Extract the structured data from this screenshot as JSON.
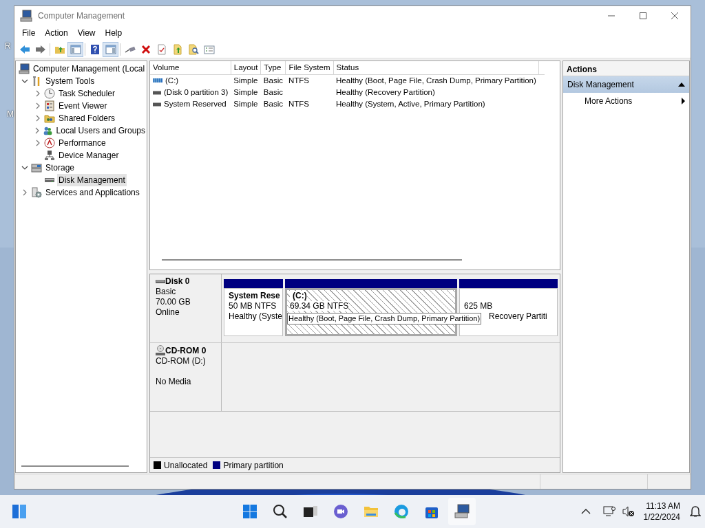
{
  "desktop": {
    "labels": [
      "R",
      "M"
    ]
  },
  "window": {
    "title": "Computer Management"
  },
  "menu": [
    "File",
    "Action",
    "View",
    "Help"
  ],
  "toolbar": [
    {
      "kind": "back",
      "pressed": false
    },
    {
      "kind": "forward",
      "pressed": false
    },
    {
      "kind": "up",
      "pressed": false
    },
    {
      "kind": "tree",
      "pressed": true
    },
    {
      "kind": "help",
      "pressed": false
    },
    {
      "kind": "pane",
      "pressed": true
    },
    {
      "kind": "connect",
      "pressed": false
    },
    {
      "kind": "delete",
      "pressed": false
    },
    {
      "kind": "properties",
      "pressed": false
    },
    {
      "kind": "export",
      "pressed": false
    },
    {
      "kind": "find",
      "pressed": false
    },
    {
      "kind": "list",
      "pressed": false
    }
  ],
  "tree": [
    {
      "label": "Computer Management (Local",
      "kind": "computer",
      "selected": false,
      "children": [
        {
          "label": "System Tools",
          "kind": "tools",
          "expanded": true,
          "selected": false,
          "children": [
            {
              "label": "Task Scheduler",
              "kind": "clock",
              "expanded": false,
              "selected": false
            },
            {
              "label": "Event Viewer",
              "kind": "log",
              "expanded": false,
              "selected": false
            },
            {
              "label": "Shared Folders",
              "kind": "folder",
              "expanded": false,
              "selected": false
            },
            {
              "label": "Local Users and Groups",
              "kind": "users",
              "expanded": false,
              "selected": false
            },
            {
              "label": "Performance",
              "kind": "performance",
              "expanded": false,
              "selected": false
            },
            {
              "label": "Device Manager",
              "kind": "device",
              "selected": false
            }
          ]
        },
        {
          "label": "Storage",
          "kind": "storage",
          "expanded": true,
          "selected": false,
          "children": [
            {
              "label": "Disk Management",
              "kind": "disk",
              "selected": true
            }
          ]
        },
        {
          "label": "Services and Applications",
          "kind": "services",
          "expanded": false,
          "selected": false
        }
      ]
    }
  ],
  "volumes": {
    "columns": [
      "Volume",
      "Layout",
      "Type",
      "File System",
      "Status"
    ],
    "rows": [
      {
        "kind": "striped",
        "cells": [
          "(C:)",
          "Simple",
          "Basic",
          "NTFS",
          "Healthy (Boot, Page File, Crash Dump, Primary Partition)"
        ]
      },
      {
        "kind": "plain",
        "cells": [
          "(Disk 0 partition 3)",
          "Simple",
          "Basic",
          "",
          "Healthy (Recovery Partition)"
        ]
      },
      {
        "kind": "plain",
        "cells": [
          "System Reserved",
          "Simple",
          "Basic",
          "NTFS",
          "Healthy (System, Active, Primary Partition)"
        ]
      }
    ]
  },
  "disks": [
    {
      "kind": "disk",
      "name": "Disk 0",
      "type": "Basic",
      "size": "70.00 GB",
      "status": "Online",
      "partitions": [
        {
          "name": "System Rese",
          "size": "50 MB NTFS",
          "status": "Healthy (Syste",
          "selected": false
        },
        {
          "name": "(C:)",
          "size": "69.34 GB NTFS",
          "selected": true
        },
        {
          "size": "625 MB",
          "status": "Recovery Partiti",
          "selected": false
        }
      ]
    },
    {
      "kind": "cdrom",
      "name": "CD-ROM 0",
      "type": "CD-ROM (D:)",
      "status": "No Media"
    }
  ],
  "tooltip": "Healthy (Boot, Page File, Crash Dump, Primary Partition)",
  "legend": [
    {
      "label": "Unallocated",
      "color": "#000000"
    },
    {
      "label": "Primary partition",
      "color": "#000080"
    }
  ],
  "actions": {
    "header": "Actions",
    "section": {
      "label": "Disk Management",
      "expanded": true
    },
    "items": [
      "More Actions"
    ]
  },
  "taskbar": {
    "time": "11:13 AM",
    "date": "1/22/2024"
  }
}
